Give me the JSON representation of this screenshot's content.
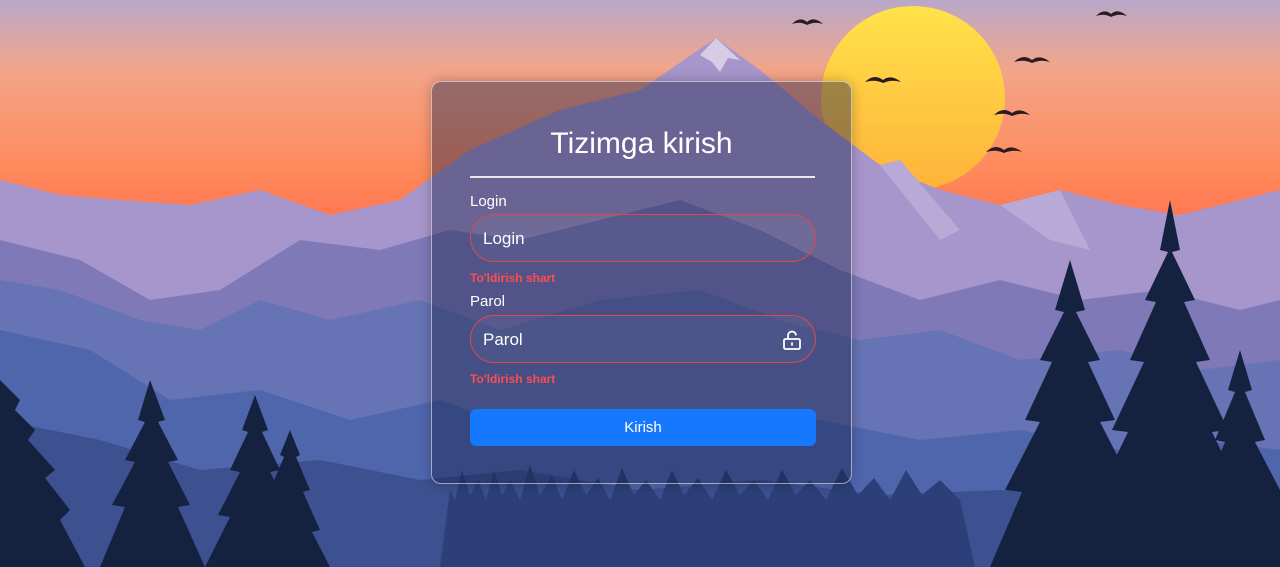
{
  "login_form": {
    "title": "Tizimga kirish",
    "login": {
      "label": "Login",
      "placeholder": "Login",
      "value": "",
      "error": "To'ldirish shart"
    },
    "password": {
      "label": "Parol",
      "placeholder": "Parol",
      "value": "",
      "error": "To'ldirish shart",
      "toggle_icon": "unlock-icon"
    },
    "submit_label": "Kirish"
  },
  "colors": {
    "error": "#ff4d4f",
    "error_border": "#e04848",
    "primary": "#1677ff",
    "sun": "#ffd84a",
    "sky_top": "#b7a6c8",
    "sky_horizon": "#ff6e4c"
  },
  "background": {
    "scene": "mountain-sunset-illustration"
  }
}
